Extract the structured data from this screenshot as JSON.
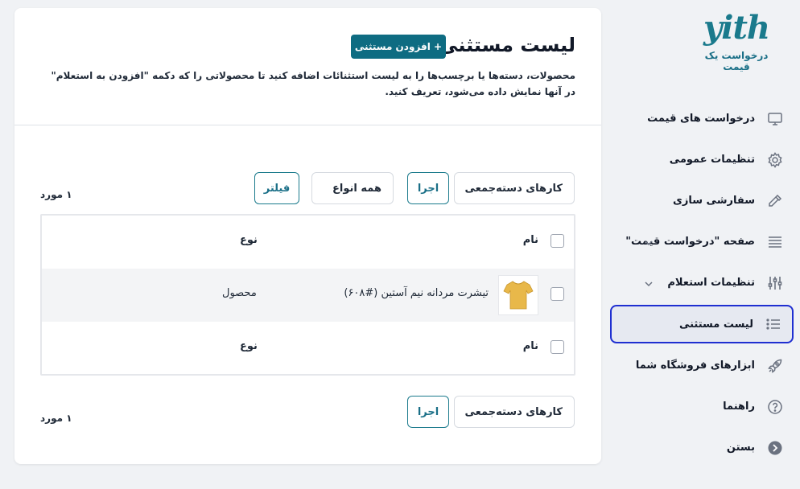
{
  "sidebar": {
    "logo_text": "yith",
    "logo_subtitle": "درخواست یک قیمت",
    "items": [
      {
        "label": "درخواست های قیمت",
        "icon": "monitor-icon"
      },
      {
        "label": "تنظیمات عمومی",
        "icon": "gear-icon"
      },
      {
        "label": "سفارشی سازی",
        "icon": "pipette-icon"
      },
      {
        "label": "صفحه \"درخواست قیمت\"",
        "icon": "page-lines-icon"
      },
      {
        "label": "تنظیمات استعلام",
        "icon": "sliders-icon"
      },
      {
        "label": "لیست مستثنی",
        "icon": "list-icon",
        "active": true
      },
      {
        "label": "ابزارهای فروشگاه شما",
        "icon": "rocket-icon"
      },
      {
        "label": "راهنما",
        "icon": "help-icon"
      },
      {
        "label": "بستن",
        "icon": "arrow-circle-icon"
      }
    ]
  },
  "main": {
    "title": "لیست مستثنی",
    "add_button": "+ افزودن مستثنی",
    "description": "محصولات، دسته‌ها یا برچسب‌ها را به لیست استثنائات اضافه کنید تا محصولاتی را که دکمه \"افزودن به استعلام\" در آنها نمایش داده می‌شود، تعریف کنید.",
    "bulk_actions": "کارهای دسته‌جمعی",
    "apply": "اجرا",
    "all_types": "همه انواع",
    "filter": "فیلتر",
    "count": "۱ مورد",
    "table": {
      "col_name": "نام",
      "col_type": "نوع",
      "rows": [
        {
          "name": "تیشرت مردانه نیم آستین (#۶۰۸)",
          "type": "محصول"
        }
      ]
    }
  },
  "colors": {
    "accent": "#0e6c82",
    "active_border": "#1f2fd1"
  }
}
